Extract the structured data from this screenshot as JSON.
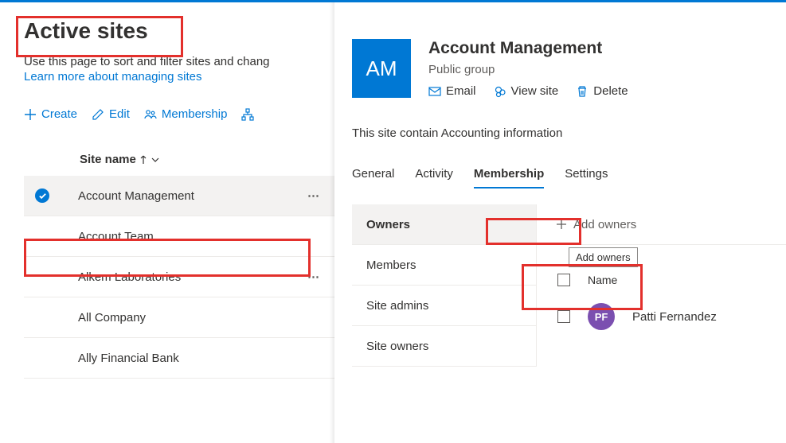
{
  "page": {
    "title": "Active sites",
    "description": "Use this page to sort and filter sites and chang",
    "learn_more": "Learn more about managing sites"
  },
  "toolbar": {
    "create": "Create",
    "edit": "Edit",
    "membership": "Membership"
  },
  "table": {
    "col_site_name": "Site name",
    "rows": [
      {
        "name": "Account Management",
        "selected": true
      },
      {
        "name": "Account Team",
        "selected": false
      },
      {
        "name": "Alkem Laboratories",
        "selected": false
      },
      {
        "name": "All Company",
        "selected": false
      },
      {
        "name": "Ally Financial Bank",
        "selected": false
      }
    ]
  },
  "panel": {
    "avatar_initials": "AM",
    "title": "Account Management",
    "subtitle": "Public group",
    "actions": {
      "email": "Email",
      "view": "View site",
      "delete": "Delete"
    },
    "description": "This site contain Accounting information",
    "tabs": {
      "general": "General",
      "activity": "Activity",
      "membership": "Membership",
      "settings": "Settings"
    },
    "groups": {
      "owners": "Owners",
      "members": "Members",
      "site_admins": "Site admins",
      "site_owners": "Site owners"
    },
    "add_owners": "Add owners",
    "tooltip": "Add owners",
    "col_name": "Name",
    "member": {
      "initials": "PF",
      "name": "Patti Fernandez"
    }
  }
}
